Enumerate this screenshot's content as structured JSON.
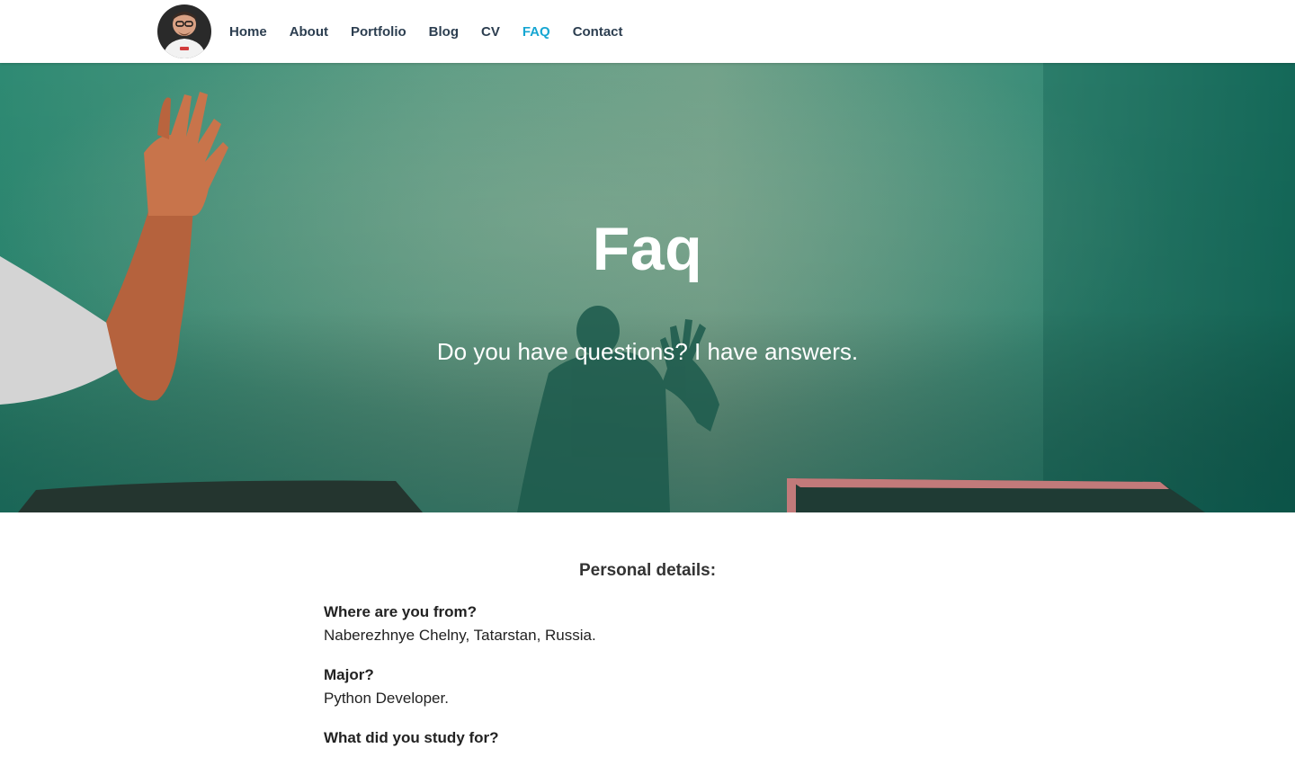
{
  "header": {
    "nav": [
      {
        "label": "Home"
      },
      {
        "label": "About"
      },
      {
        "label": "Portfolio"
      },
      {
        "label": "Blog"
      },
      {
        "label": "CV"
      },
      {
        "label": "FAQ"
      },
      {
        "label": "Contact"
      }
    ],
    "active_item": "FAQ",
    "colors": {
      "nav_text": "#2c3e50",
      "nav_active": "#16a6d2"
    }
  },
  "hero": {
    "title": "Faq",
    "subtitle": "Do you have questions? I have answers.",
    "colors": {
      "background": "#2f8a72",
      "text": "#ffffff"
    }
  },
  "content": {
    "section_title": "Personal details:",
    "faq": [
      {
        "question": "Where are you from?",
        "answer": "Naberezhnye Chelny, Tatarstan, Russia."
      },
      {
        "question": "Major?",
        "answer": "Python Developer."
      },
      {
        "question": "What did you study for?",
        "answer": ""
      }
    ]
  }
}
